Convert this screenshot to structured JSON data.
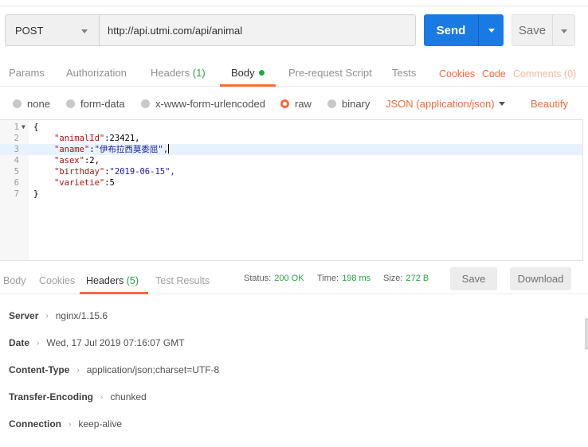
{
  "request": {
    "method": "POST",
    "url": "http://api.utmi.com/api/animal",
    "send_label": "Send",
    "save_label": "Save"
  },
  "request_tabs": {
    "params": "Params",
    "authorization": "Authorization",
    "headers": "Headers",
    "headers_count": "(1)",
    "body": "Body",
    "prerequest": "Pre-request Script",
    "tests": "Tests",
    "cookies": "Cookies",
    "code": "Code",
    "comments": "Comments (0)"
  },
  "body_types": {
    "none": "none",
    "form_data": "form-data",
    "urlencoded": "x-www-form-urlencoded",
    "raw": "raw",
    "binary": "binary",
    "selected": "raw",
    "content_type": "JSON (application/json)",
    "beautify": "Beautify"
  },
  "editor": {
    "lines": [
      {
        "num": "1",
        "text": "{"
      },
      {
        "num": "2",
        "key": "\"animalId\"",
        "sep": ":",
        "value": "23421,"
      },
      {
        "num": "3",
        "key": "\"aname\"",
        "sep": ":",
        "value": "\"伊布拉西莫委屈\","
      },
      {
        "num": "4",
        "key": "\"asex\"",
        "sep": ":",
        "value": "2,"
      },
      {
        "num": "5",
        "key": "\"birthday\"",
        "sep": ":",
        "value": "\"2019-06-15\","
      },
      {
        "num": "6",
        "key": "\"varietie\"",
        "sep": ":",
        "value": "5"
      },
      {
        "num": "7",
        "text": "}"
      }
    ]
  },
  "response_tabs": {
    "body": "Body",
    "cookies": "Cookies",
    "headers": "Headers",
    "headers_count": "(5)",
    "test_results": "Test Results"
  },
  "response_meta": {
    "status_label": "Status:",
    "status_value": "200 OK",
    "time_label": "Time:",
    "time_value": "198 ms",
    "size_label": "Size:",
    "size_value": "272 B",
    "save_label": "Save",
    "download_label": "Download"
  },
  "response_headers": [
    {
      "name": "Server",
      "value": "nginx/1.15.6"
    },
    {
      "name": "Date",
      "value": "Wed, 17 Jul 2019 07:16:07 GMT"
    },
    {
      "name": "Content-Type",
      "value": "application/json;charset=UTF-8"
    },
    {
      "name": "Transfer-Encoding",
      "value": "chunked"
    },
    {
      "name": "Connection",
      "value": "keep-alive"
    }
  ],
  "colors": {
    "accent": "#f26b3a",
    "send": "#1a7ae3",
    "success": "#27a34a"
  }
}
